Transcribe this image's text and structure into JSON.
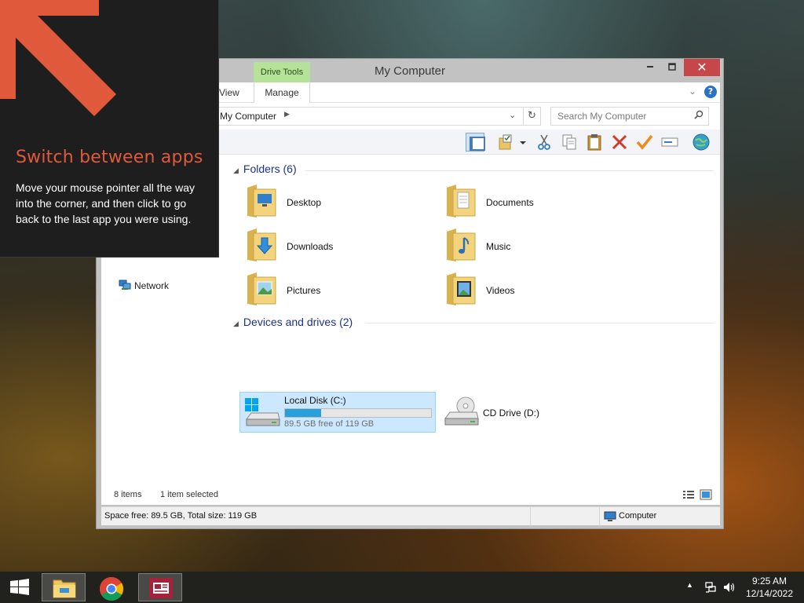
{
  "window": {
    "title": "My Computer",
    "contextual_tab_group": "Drive Tools",
    "tabs": {
      "view": "View",
      "manage": "Manage"
    },
    "close_glyph": "✕",
    "minimize_glyph": "▭",
    "maximize_glyph": "□",
    "help_glyph": "?"
  },
  "address": {
    "path": "My Computer",
    "separator": "▶",
    "search_placeholder": "Search My Computer"
  },
  "nav": {
    "network_label": "Network"
  },
  "groups": {
    "folders_header": "Folders (6)",
    "devices_header": "Devices and drives (2)"
  },
  "folders": [
    {
      "name": "Desktop",
      "icon": "desktop-folder-icon"
    },
    {
      "name": "Documents",
      "icon": "documents-folder-icon"
    },
    {
      "name": "Downloads",
      "icon": "downloads-folder-icon"
    },
    {
      "name": "Music",
      "icon": "music-folder-icon"
    },
    {
      "name": "Pictures",
      "icon": "pictures-folder-icon"
    },
    {
      "name": "Videos",
      "icon": "videos-folder-icon"
    }
  ],
  "drives": {
    "local": {
      "name": "Local Disk (C:)",
      "free_text": "89.5 GB free of 119 GB",
      "used_fraction": 0.248
    },
    "cd": {
      "name": "CD Drive (D:)"
    }
  },
  "status": {
    "items_count": "8 items",
    "selection": "1 item selected"
  },
  "details": {
    "space": "Space free: 89.5 GB, Total size: 119 GB",
    "location": "Computer"
  },
  "tip": {
    "title": "Switch between apps",
    "body": "Move your mouse pointer all the way into the corner, and then click to go back to the last app you were using."
  },
  "taskbar": {
    "time": "9:25 AM",
    "date": "12/14/2022",
    "tray_chevron": "▲"
  },
  "colors": {
    "accent": "#26a0da",
    "tip_title": "#e0593a",
    "close_button": "#c7464a",
    "drive_tools": "#b4e297"
  }
}
